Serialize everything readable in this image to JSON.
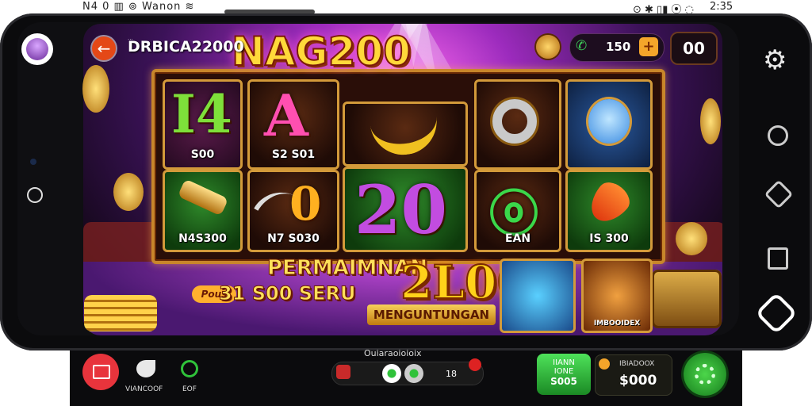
{
  "status_bar": {
    "left_text": "N4 0 ▥ ⊚ Wanon ≋",
    "right_icons": "⊙ ✱ ▯▮ ⦿ ◌",
    "time": "2:35"
  },
  "game": {
    "code_prefix": "...",
    "code": "DRBICA22000",
    "title": "NAG200",
    "balance": "150",
    "plus": "+",
    "score": "00"
  },
  "reels": [
    {
      "glyph": "I4",
      "label": "S00"
    },
    {
      "glyph": "A",
      "label": "S2 S01"
    },
    {
      "glyph": "",
      "label": ""
    },
    {
      "glyph": "",
      "label": ""
    },
    {
      "glyph": "",
      "label": ""
    },
    {
      "glyph": "",
      "label": "N4S300"
    },
    {
      "glyph": "0",
      "label": "N7 S030"
    },
    {
      "glyph": "20",
      "label": ""
    },
    {
      "glyph": "ⓞ",
      "label": "EAN"
    },
    {
      "glyph": "",
      "label": "IS 300"
    }
  ],
  "banner": {
    "title": "PERMAIMNAN",
    "big": "2L00",
    "tag": "Pous",
    "line2": "31 S00 SERU",
    "sub": "MENGUNTUNGAN",
    "badge_bottom": "IMBOOIDEX"
  },
  "side_controls": {
    "settings_label": "⚙"
  },
  "bottom": {
    "caption": "Ouiaraoioioix",
    "label_left": "VIANCOOF",
    "label_second": "EOF",
    "toggle_value": "18",
    "win_btn_line1": "IIANN",
    "win_btn_line2": "IONE",
    "win_btn_amount": "S005",
    "win_box_label": "IBIADOOX",
    "win_box_amount": "$000"
  },
  "colors": {
    "accent_gold": "#ffd21a",
    "brand_purple": "#9c2bbd",
    "spin_green": "#4cd64a",
    "back_orange": "#e44817"
  }
}
